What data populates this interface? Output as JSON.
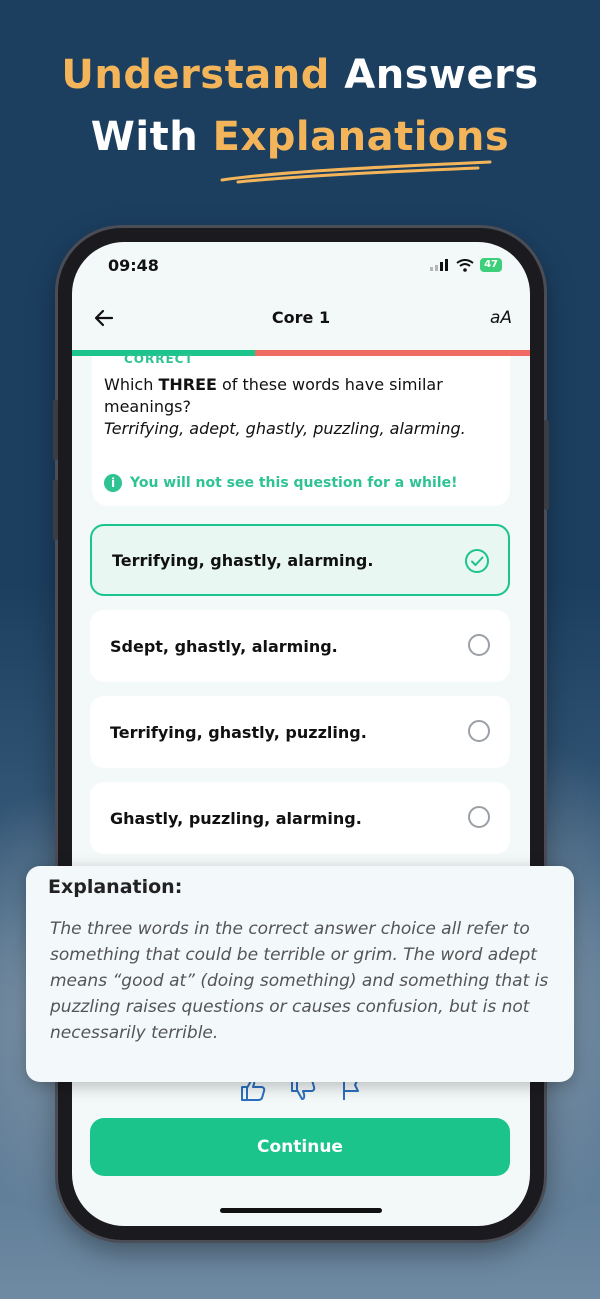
{
  "headline": {
    "line1_accent": "Understand",
    "line1_rest": " Answers",
    "line2_start": "With ",
    "line2_accent": "Explanations"
  },
  "status": {
    "time": "09:48",
    "battery": "47"
  },
  "nav": {
    "title": "Core 1",
    "font_toggle": "aA"
  },
  "progress": {
    "value": 0.4
  },
  "question": {
    "label": "CORRECT",
    "text_before": "Which ",
    "text_emphasis": "THREE",
    "text_after": " of these words have similar meanings?",
    "words": "Terrifying, adept, ghastly, puzzling, alarming.",
    "info": "You will not see this question for a while!"
  },
  "options": [
    {
      "label": "Terrifying, ghastly, alarming.",
      "selected": true
    },
    {
      "label": "Sdept, ghastly, alarming.",
      "selected": false
    },
    {
      "label": "Terrifying, ghastly, puzzling.",
      "selected": false
    },
    {
      "label": "Ghastly, puzzling, alarming.",
      "selected": false
    }
  ],
  "explanation": {
    "title": "Explanation:",
    "body": "The three words in the correct answer choice all refer to something that could be terrible or grim. The word adept means “good at” (doing something) and something that is puzzling raises questions or causes confusion, but is not necessarily terrible."
  },
  "buttons": {
    "continue": "Continue"
  },
  "colors": {
    "accent": "#f4b55a",
    "primary": "#1bc48a",
    "error": "#ef6b63",
    "background": "#1c3f60"
  }
}
